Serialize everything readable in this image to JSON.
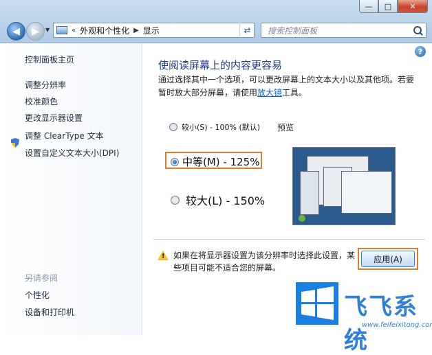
{
  "window": {
    "min": "—",
    "max": "□",
    "close": "✕"
  },
  "addressbar": {
    "prefix": "«",
    "crumbs": [
      "外观和个性化",
      "显示"
    ]
  },
  "search": {
    "placeholder": "搜索控制面板"
  },
  "sidebar": {
    "items": [
      "控制面板主页",
      "调整分辨率",
      "校准颜色",
      "更改显示器设置",
      "调整 ClearType 文本",
      "设置自定义文本大小(DPI)"
    ],
    "see_also": "另请参阅",
    "related": [
      "个性化",
      "设备和打印机"
    ]
  },
  "main": {
    "help": "?",
    "title": "使阅读屏幕上的内容更容易",
    "desc_before": "通过选择其中一个选项，可以更改屏幕上的文本大小以及其他项。若要暂时放大部分屏幕，请使用",
    "magnifier": "放大镜",
    "desc_after": "工具。",
    "options": [
      {
        "label": "较小(S) - 100% (默认)",
        "selected": false
      },
      {
        "label": "中等(M) - 125%",
        "selected": true
      },
      {
        "label": "较大(L) - 150%",
        "selected": false
      }
    ],
    "preview_label": "预览",
    "warning": "如果在将显示器设置为该分辨率时选择此设置，某些项目可能不适合您的屏幕。",
    "apply": "应用(A)"
  },
  "watermark": {
    "name": "飞飞系统",
    "url": "www.feifeixitong.com"
  },
  "colors": {
    "highlight": "#e07b2a",
    "link": "#1565c0",
    "title": "#1e3a8c"
  }
}
